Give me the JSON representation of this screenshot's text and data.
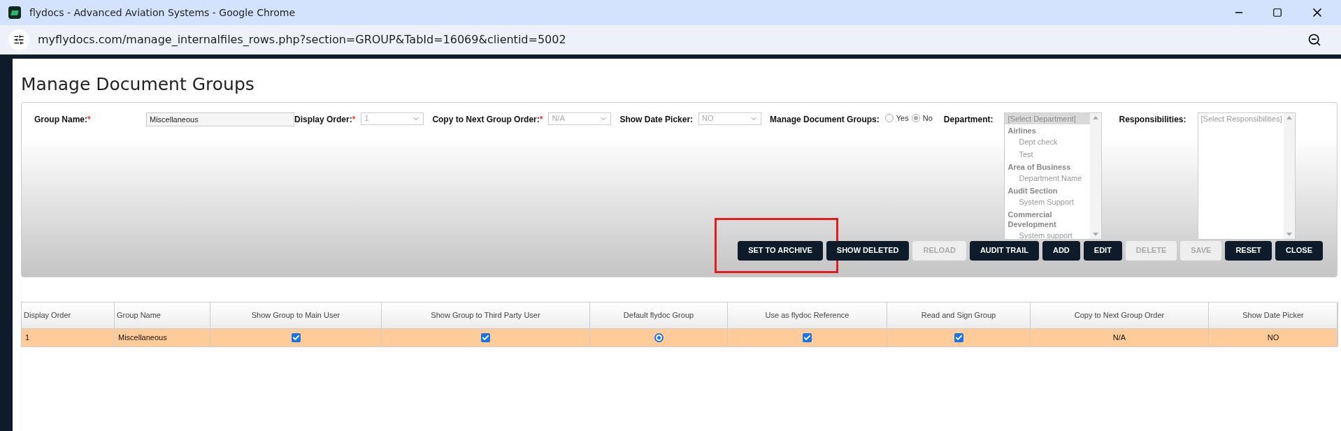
{
  "window": {
    "title": "flydocs - Advanced Aviation Systems - Google Chrome",
    "address": "myflydocs.com/manage_internalfiles_rows.php?section=GROUP&TabId=16069&clientid=5002"
  },
  "heading": "Manage Document Groups",
  "form": {
    "fields": [
      {
        "kind": "text",
        "label": "Group Name:",
        "required_mark": "*",
        "value": "Miscellaneous"
      },
      {
        "kind": "select",
        "label": "Display Order:",
        "required_mark": "*",
        "value": "1",
        "disabled": true
      },
      {
        "kind": "select",
        "label": "Copy to Next Group Order:",
        "required_mark": "*",
        "value": "N/A",
        "disabled": true
      },
      {
        "kind": "select",
        "label": "Show Date Picker:",
        "value": "NO",
        "disabled": true
      },
      {
        "kind": "radio",
        "label": "Manage Document Groups:",
        "options": [
          {
            "label": "Yes",
            "selected": false
          },
          {
            "label": "No",
            "selected": true
          }
        ]
      },
      {
        "kind": "listbox",
        "label": "Department:",
        "placeholder": "[Select Department]",
        "placeholder_selected": true,
        "groups": [
          {
            "label": "Airlines",
            "children": [
              {
                "label": "Dept check"
              },
              {
                "label": "Test"
              }
            ]
          },
          {
            "label": "Area of Business",
            "children": [
              {
                "label": "Department Name"
              }
            ]
          },
          {
            "label": "Audit Section",
            "children": [
              {
                "label": "System Support"
              }
            ]
          },
          {
            "label": "Commercial Development",
            "children": [
              {
                "label": "System support"
              }
            ]
          }
        ]
      },
      {
        "kind": "listbox",
        "label": "Responsibilities:",
        "placeholder": "[Select Responsibilities]",
        "placeholder_selected": false
      }
    ]
  },
  "buttons": [
    {
      "label": "SET TO ARCHIVE",
      "disabled": false,
      "highlighted": true
    },
    {
      "label": "SHOW DELETED",
      "disabled": false,
      "highlighted": false
    },
    {
      "label": "RELOAD",
      "disabled": true,
      "highlighted": false
    },
    {
      "label": "AUDIT TRAIL",
      "disabled": false,
      "highlighted": false
    },
    {
      "label": "ADD",
      "disabled": false,
      "highlighted": false
    },
    {
      "label": "EDIT",
      "disabled": false,
      "highlighted": false
    },
    {
      "label": "DELETE",
      "disabled": true,
      "highlighted": false
    },
    {
      "label": "SAVE",
      "disabled": true,
      "highlighted": false
    },
    {
      "label": "RESET",
      "disabled": false,
      "highlighted": false
    },
    {
      "label": "CLOSE",
      "disabled": false,
      "highlighted": false
    }
  ],
  "table": {
    "columns": [
      "Display Order",
      "Group Name",
      "Show Group to Main User",
      "Show Group to Third Party User",
      "Default flydoc Group",
      "Use as flydoc Reference",
      "Read and Sign Group",
      "Copy to Next Group Order",
      "Show Date Picker"
    ],
    "rows": [
      {
        "selected": true,
        "cells": [
          {
            "kind": "text",
            "text": "1"
          },
          {
            "kind": "text",
            "text": "Miscellaneous"
          },
          {
            "kind": "checkbox",
            "checked": true
          },
          {
            "kind": "checkbox",
            "checked": true
          },
          {
            "kind": "radio",
            "selected": true
          },
          {
            "kind": "checkbox",
            "checked": true
          },
          {
            "kind": "checkbox",
            "checked": true
          },
          {
            "kind": "text",
            "text": "N/A"
          },
          {
            "kind": "text",
            "text": "NO"
          }
        ]
      }
    ]
  }
}
